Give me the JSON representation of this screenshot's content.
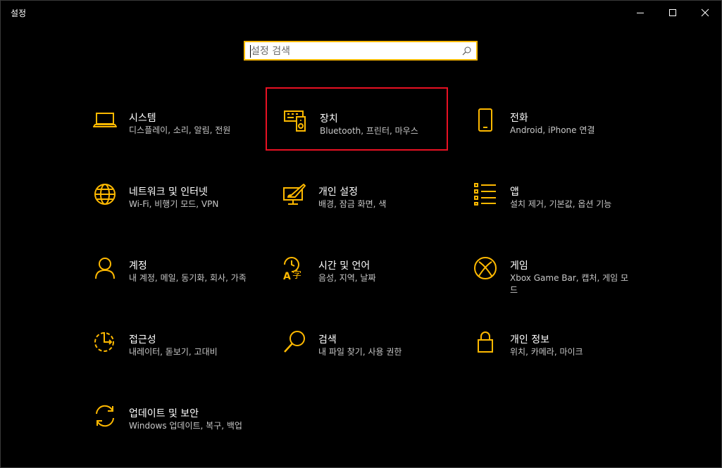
{
  "window": {
    "title": "설정",
    "accent": "#ffb900",
    "selection_color": "#e81123"
  },
  "search": {
    "placeholder": "설정 검색",
    "value": ""
  },
  "tiles": [
    {
      "name": "시스템",
      "desc": "디스플레이, 소리, 알림, 전원",
      "icon": "laptop-icon"
    },
    {
      "name": "장치",
      "desc": "Bluetooth, 프린터, 마우스",
      "icon": "devices-icon",
      "selected": true
    },
    {
      "name": "전화",
      "desc": "Android, iPhone 연결",
      "icon": "phone-icon"
    },
    {
      "name": "네트워크 및 인터넷",
      "desc": "Wi-Fi, 비행기 모드, VPN",
      "icon": "globe-icon"
    },
    {
      "name": "개인 설정",
      "desc": "배경, 잠금 화면, 색",
      "icon": "personalization-icon"
    },
    {
      "name": "앱",
      "desc": "설치 제거, 기본값, 옵션 기능",
      "icon": "apps-list-icon"
    },
    {
      "name": "계정",
      "desc": "내 계정, 메일, 동기화, 회사, 가족",
      "icon": "person-icon"
    },
    {
      "name": "시간 및 언어",
      "desc": "음성, 지역, 날짜",
      "icon": "time-language-icon"
    },
    {
      "name": "게임",
      "desc": "Xbox Game Bar, 캡처, 게임 모드",
      "icon": "xbox-icon"
    },
    {
      "name": "접근성",
      "desc": "내레이터, 돋보기, 고대비",
      "icon": "ease-of-access-icon"
    },
    {
      "name": "검색",
      "desc": "내 파일 찾기, 사용 권한",
      "icon": "search-icon"
    },
    {
      "name": "개인 정보",
      "desc": "위치, 카메라, 마이크",
      "icon": "lock-icon"
    },
    {
      "name": "업데이트 및 보안",
      "desc": "Windows 업데이트, 복구, 백업",
      "icon": "update-icon"
    }
  ]
}
